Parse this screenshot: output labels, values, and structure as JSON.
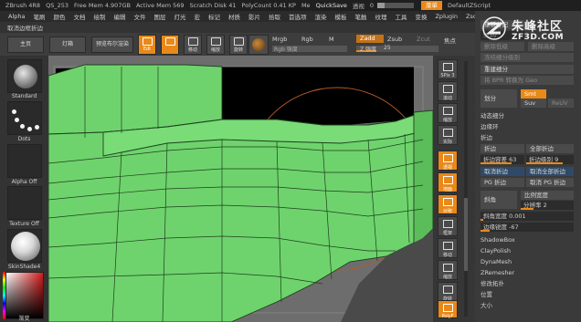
{
  "titlebar": {
    "app": "ZBrush 4R8",
    "project": "QS_253",
    "free_mem": "Free Mem 4.907GB",
    "active_mem": "Active Mem 569",
    "scratch": "Scratch Disk 41",
    "polycount": "PolyCount 0.41 KP",
    "me": "Me",
    "quicksave": "QuickSave",
    "transparency_label": "透视",
    "transparency_value": "0",
    "menu_btn": "菜单",
    "script": "DefaultZScript"
  },
  "menubar": [
    "Alpha",
    "笔刷",
    "颜色",
    "文档",
    "绘制",
    "编辑",
    "文件",
    "图层",
    "灯光",
    "宏",
    "标记",
    "材质",
    "影片",
    "拾取",
    "首选项",
    "渲染",
    "模板",
    "笔触",
    "纹理",
    "工具",
    "变换",
    "Zplugin",
    "Zscript"
  ],
  "subbar": {
    "label": "取消边框折边"
  },
  "toolbar": {
    "home": "主页",
    "lightbox": "灯箱",
    "preview": "预览布尔渲染",
    "edit": "Edt",
    "move": "移动",
    "scale": "缩放",
    "rotate": "旋转",
    "mrgb": "Mrgb",
    "rgb": "Rgb",
    "m": "M",
    "zadd": "Zadd",
    "zsub": "Zsub",
    "zcut": "Zcut",
    "rgb_intensity": "Rgb 强度",
    "z_intensity": "Z 强度",
    "z_intensity_value": "25",
    "focal": "焦点"
  },
  "leftpanel": {
    "brush": "Standard",
    "stroke": "Dots",
    "alpha": "Alpha Off",
    "texture": "Texture Off",
    "material": "SkinShade4",
    "picker_bottom": "渐变"
  },
  "rightstrip": [
    {
      "label": "SPix 3"
    },
    {
      "label": "滚动"
    },
    {
      "label": "缩放"
    },
    {
      "label": "实际"
    },
    {
      "label": "透视"
    },
    {
      "label": "地面"
    },
    {
      "label": "对称"
    },
    {
      "label": "框架"
    },
    {
      "label": "移动"
    },
    {
      "label": "缩放"
    },
    {
      "label": "旋转"
    },
    {
      "label": "PolyF"
    }
  ],
  "watermark": {
    "cn": "朱峰社区",
    "en": "ZF3D.COM"
  },
  "rightpanel": {
    "top_values": [
      "重新分配",
      "SDiv",
      "删除低级",
      "删除高级",
      "冻结细分级别"
    ],
    "reconstruct": "重建细分",
    "convert_bpr": "将 BPR 转换为 Geo",
    "divide": "划分",
    "smt": "Smt",
    "suv": "Suv",
    "reuv": "ReUV",
    "dynamic_subdiv": "动态细分",
    "edge_loop": "边缘环",
    "crease_header": "折边",
    "crease": "折边",
    "crease_all": "全部折边",
    "crease_tolerance_label": "折边容差",
    "crease_tolerance_value": "63",
    "crease_level_label": "折边级别",
    "crease_level_value": "9",
    "uncrease": "取消折边",
    "uncrease_all": "取消全部折边",
    "pg_crease": "PG 折边",
    "pg_uncrease": "取消 PG 折边",
    "bevel": "斜角",
    "bevel_width_label": "比例宽度",
    "bevel_res_label": "分辨率",
    "bevel_res_value": "2",
    "bevel_amount_label": "斜角宽度",
    "bevel_amount_value": "0.001",
    "edge_offset_label": "边缘锐度",
    "edge_offset_value": "-67",
    "shadowbox": "ShadowBox",
    "claypolish": "ClayPolish",
    "dynamesh": "DynaMesh",
    "zremesher": "ZRemesher",
    "modify_topo": "修改拓扑",
    "position": "位置",
    "size": "大小"
  },
  "colors": {
    "accent": "#e8891a",
    "mesh_green": "#6fd36d",
    "canvas_bg": "#6d6d6d",
    "panel_bg": "#3a3a3a",
    "blue_button": "#2f4a68"
  }
}
